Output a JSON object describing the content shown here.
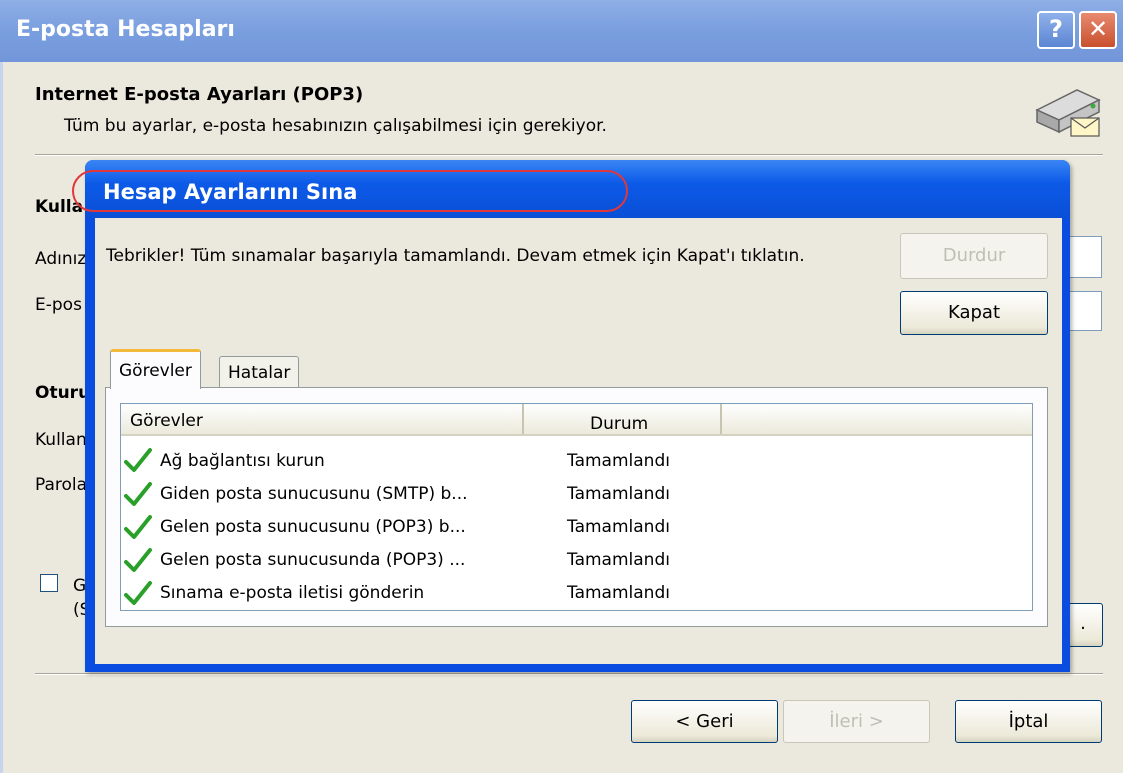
{
  "window": {
    "title": "E-posta Hesapları",
    "help_glyph": "?",
    "close_glyph": "✕"
  },
  "header": {
    "title": "Internet E-posta Ayarları (POP3)",
    "subtitle": "Tüm bu ayarlar, e-posta hesabınızın çalışabilmesi için gerekiyor."
  },
  "background_form": {
    "user_section_partial": "Kulla",
    "name_label_partial": "Adınız",
    "email_label_partial": "E-pos",
    "logon_section_partial": "Oturu",
    "username_label_partial": "Kullan",
    "password_label_partial": "Parola",
    "checkbox_label_partial_1": "G",
    "checkbox_label_partial_2": "(S",
    "more_button_partial": "."
  },
  "wizard_buttons": {
    "back": "< Geri",
    "next": "İleri >",
    "cancel": "İptal"
  },
  "dialog": {
    "title": "Hesap Ayarlarını Sına",
    "message": "Tebrikler! Tüm sınamalar başarıyla tamamlandı. Devam etmek için Kapat'ı tıklatın.",
    "stop_button": "Durdur",
    "close_button": "Kapat",
    "tabs": [
      "Görevler",
      "Hatalar"
    ],
    "columns": [
      "Görevler",
      "Durum"
    ],
    "rows": [
      {
        "task": "Ağ bağlantısı kurun",
        "status": "Tamamlandı"
      },
      {
        "task": "Giden posta sunucusunu (SMTP) b...",
        "status": "Tamamlandı"
      },
      {
        "task": "Gelen posta sunucusunu (POP3) b...",
        "status": "Tamamlandı"
      },
      {
        "task": "Gelen posta sunucusunda (POP3) ...",
        "status": "Tamamlandı"
      },
      {
        "task": "Sınama e-posta iletisi gönderin",
        "status": "Tamamlandı"
      }
    ]
  },
  "colors": {
    "window_title": "#7a9fdf",
    "dialog_title": "#0c5ae8",
    "face": "#ebe9dd",
    "check": "#2aa02a",
    "highlight": "#e0383a"
  }
}
